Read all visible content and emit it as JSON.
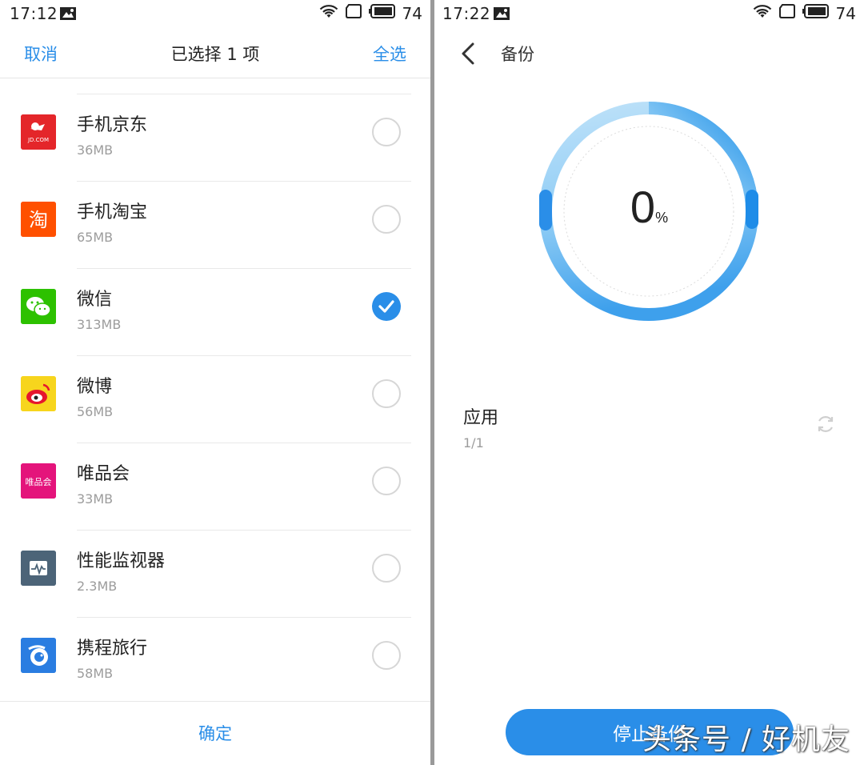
{
  "left_screen": {
    "status_time": "17:12",
    "battery": "74",
    "cancel_label": "取消",
    "title": "已选择 1 项",
    "select_all_label": "全选",
    "apps": [
      {
        "name": "手机京东",
        "size": "36MB",
        "checked": false,
        "icon": "jd-icon",
        "icon_text": "JD.COM",
        "color": "#e4262a"
      },
      {
        "name": "手机淘宝",
        "size": "65MB",
        "checked": false,
        "icon": "taobao-icon",
        "icon_text": "淘",
        "color": "#ff5000"
      },
      {
        "name": "微信",
        "size": "313MB",
        "checked": true,
        "icon": "wechat-icon",
        "icon_text": "",
        "color": "#2dc100"
      },
      {
        "name": "微博",
        "size": "56MB",
        "checked": false,
        "icon": "weibo-icon",
        "icon_text": "",
        "color": "#f7d51d"
      },
      {
        "name": "唯品会",
        "size": "33MB",
        "checked": false,
        "icon": "vip-icon",
        "icon_text": "唯品会",
        "color": "#e4147b"
      },
      {
        "name": "性能监视器",
        "size": "2.3MB",
        "checked": false,
        "icon": "monitor-icon",
        "icon_text": "",
        "color": "#4c6478"
      },
      {
        "name": "携程旅行",
        "size": "58MB",
        "checked": false,
        "icon": "ctrip-icon",
        "icon_text": "",
        "color": "#2a7de1"
      }
    ],
    "confirm_label": "确定"
  },
  "right_screen": {
    "status_time": "17:22",
    "battery": "74",
    "title": "备份",
    "progress_percent": 0,
    "progress_number": "0",
    "progress_sign": "%",
    "section_title": "应用",
    "section_count": "1/1",
    "stop_label": "停止备份"
  },
  "watermark": "头条号 / 好机友",
  "colors": {
    "accent": "#2a8ee8",
    "ring_light": "#d4ecfb",
    "ring_mid": "#5fb4ef"
  }
}
